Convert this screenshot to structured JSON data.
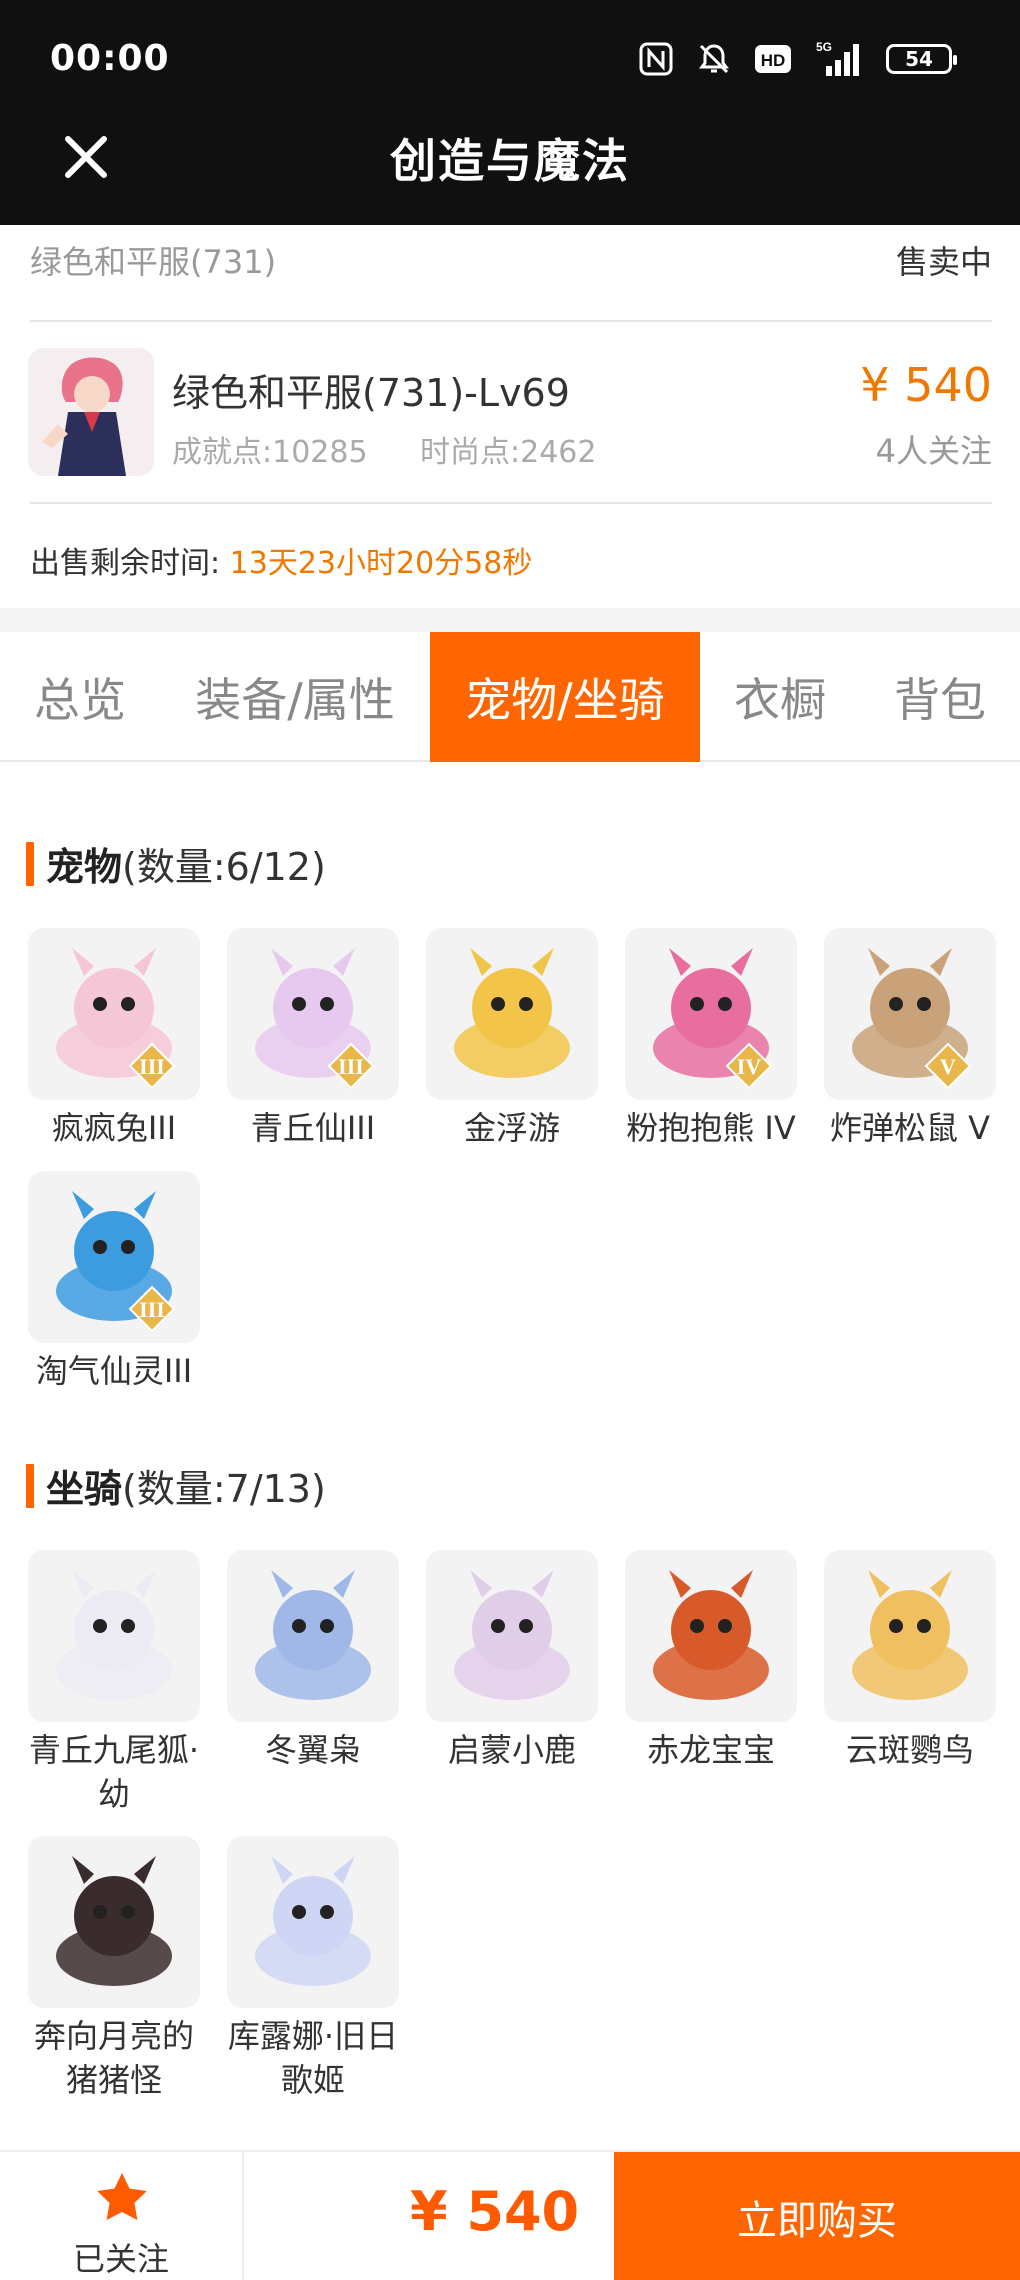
{
  "status_bar": {
    "time": "00:00",
    "battery": "54"
  },
  "title_bar": {
    "title": "创造与魔法"
  },
  "header": {
    "account_name": "绿色和平服(731)",
    "sale_status": "售卖中"
  },
  "character": {
    "title": "绿色和平服(731)-Lv69",
    "achievement": "成就点:10285",
    "fashion": "时尚点:2462",
    "price": "¥ 540",
    "followers": "4人关注"
  },
  "remaining": {
    "label": "出售剩余时间:",
    "value": "13天23小时20分58秒"
  },
  "tabs": [
    {
      "label": "总览",
      "active": false
    },
    {
      "label": "装备/属性",
      "active": false
    },
    {
      "label": "宠物/坐骑",
      "active": true
    },
    {
      "label": "衣橱",
      "active": false
    },
    {
      "label": "背包",
      "active": false
    }
  ],
  "pets_section": {
    "title": "宠物",
    "count": "(数量:6/12)",
    "items": [
      {
        "name": "疯疯兔III",
        "rank": "III",
        "color": "#f4c6d6"
      },
      {
        "name": "青丘仙III",
        "rank": "III",
        "color": "#e7c9ef"
      },
      {
        "name": "金浮游",
        "rank": "",
        "color": "#f2c54a"
      },
      {
        "name": "粉抱抱熊 IV",
        "rank": "IV",
        "color": "#e86ea0"
      },
      {
        "name": "炸弹松鼠 V",
        "rank": "V",
        "color": "#c9a27a"
      },
      {
        "name": "淘气仙灵III",
        "rank": "III",
        "color": "#3d9be0"
      }
    ]
  },
  "mounts_section": {
    "title": "坐骑",
    "count": "(数量:7/13)",
    "items": [
      {
        "name": "青丘九尾狐·幼",
        "color": "#ecebf3"
      },
      {
        "name": "冬翼枭",
        "color": "#9fb8e8"
      },
      {
        "name": "启蒙小鹿",
        "color": "#e0cde8"
      },
      {
        "name": "赤龙宝宝",
        "color": "#d85a2a"
      },
      {
        "name": "云斑鹦鸟",
        "color": "#f0c060"
      },
      {
        "name": "奔向月亮的猪猪怪",
        "color": "#3a2c2c"
      },
      {
        "name": "库露娜·旧日歌姬",
        "color": "#cfd6f5"
      }
    ]
  },
  "bottom_bar": {
    "follow_label": "已关注",
    "price": "¥ 540",
    "buy_label": "立即购买"
  },
  "colors": {
    "accent": "#ff6600",
    "price": "#f07800"
  },
  "icons": [
    "close-icon",
    "nfc-icon",
    "mute-icon",
    "hd-icon",
    "signal-icon",
    "battery-icon",
    "star-icon"
  ]
}
